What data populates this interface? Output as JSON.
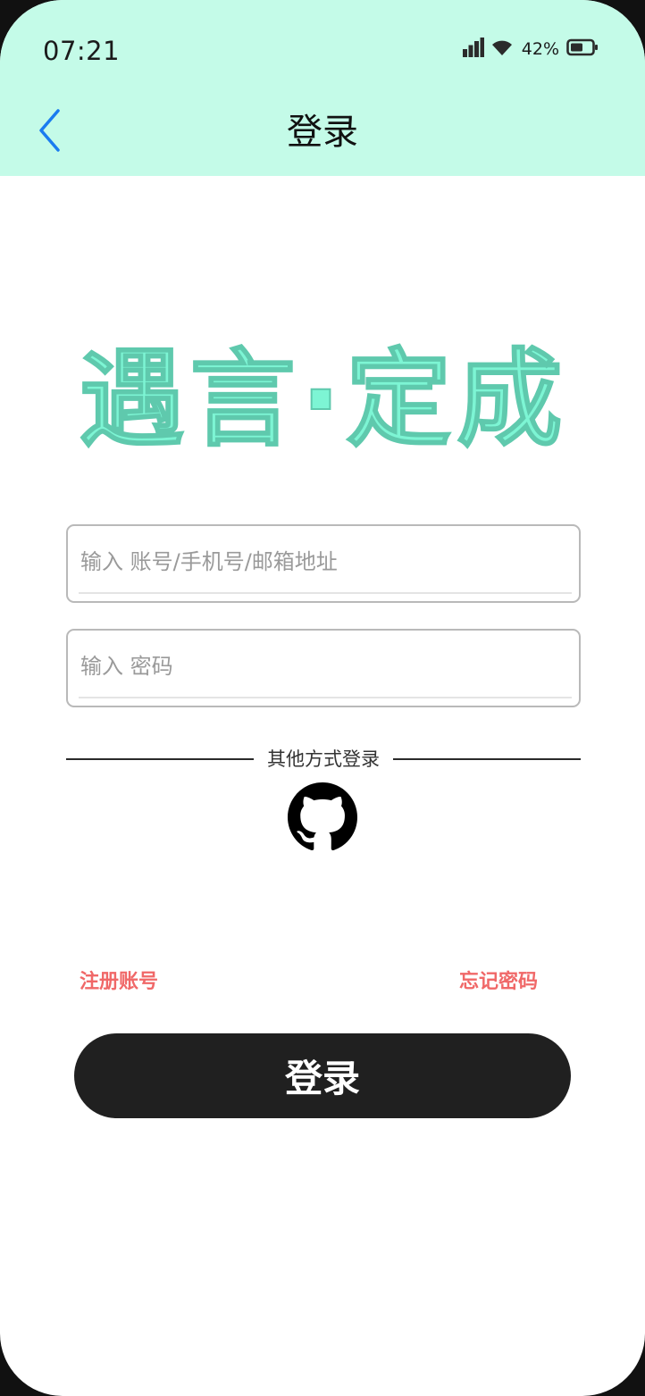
{
  "status_bar": {
    "time": "07:21",
    "battery_percent": "42%",
    "icons": [
      "signal-icon",
      "wifi-icon",
      "battery-icon"
    ]
  },
  "nav": {
    "title": "登录",
    "back_icon": "chevron-left-icon"
  },
  "logo": {
    "text": "遇言·定成",
    "color": "#7df5d4"
  },
  "form": {
    "account_placeholder": "输入 账号/手机号/邮箱地址",
    "account_value": "",
    "password_placeholder": "输入 密码",
    "password_value": ""
  },
  "other_login": {
    "label": "其他方式登录",
    "providers": [
      "github-icon"
    ]
  },
  "links": {
    "register": "注册账号",
    "forgot_password": "忘记密码"
  },
  "login_button": {
    "label": "登录"
  },
  "colors": {
    "header_bg": "#c4fbe8",
    "accent_link": "#f06868",
    "back_icon": "#1a7cf0",
    "button_bg": "#202020"
  }
}
